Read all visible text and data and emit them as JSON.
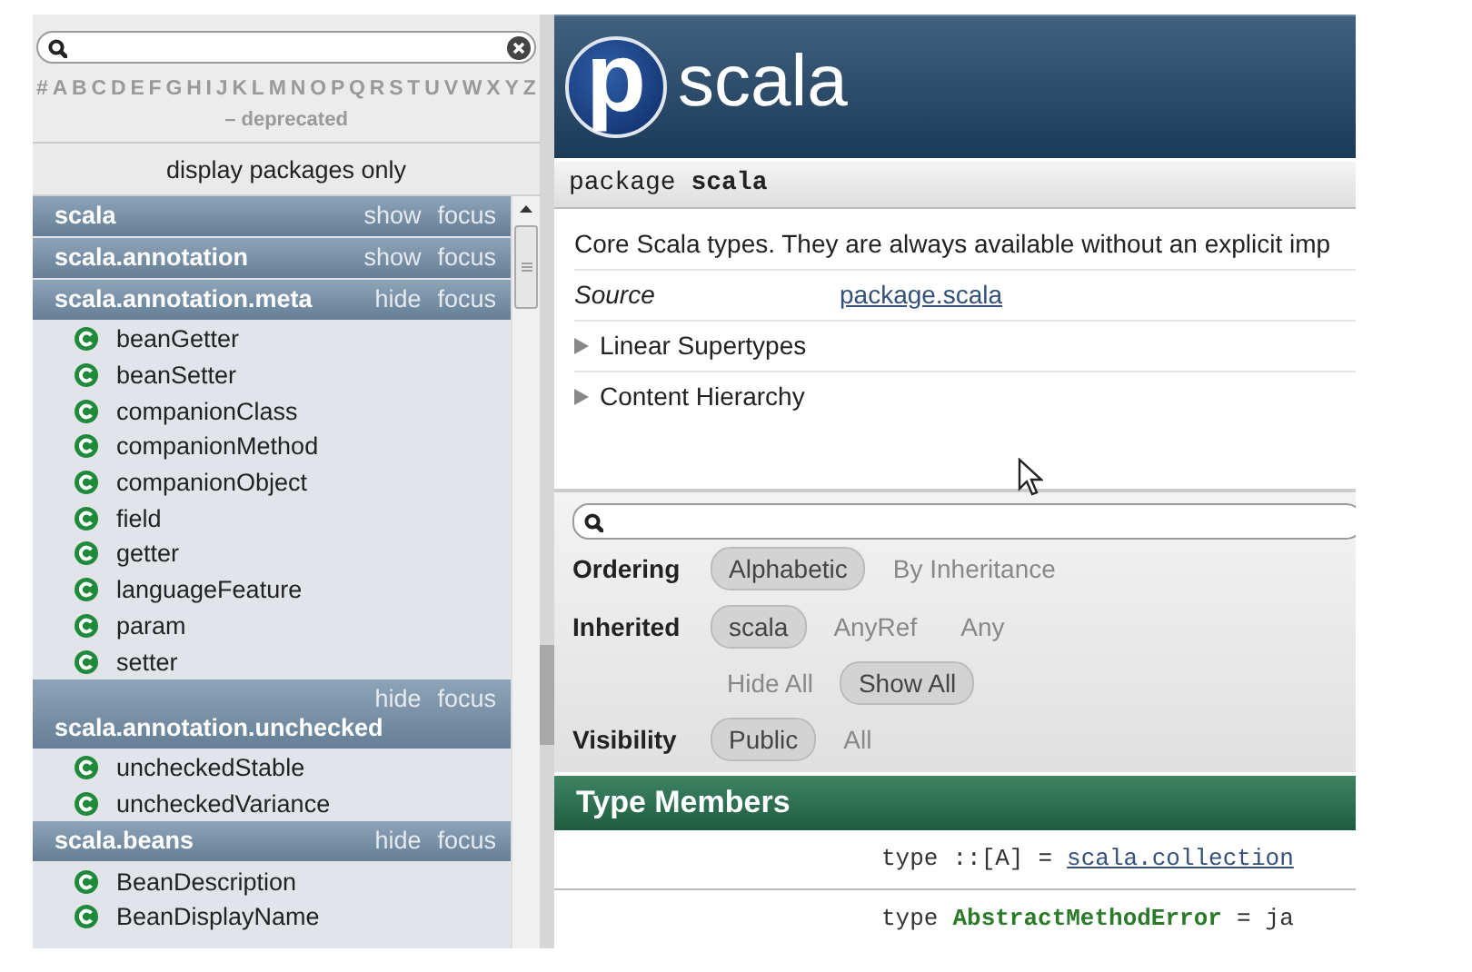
{
  "sidebar": {
    "letters": [
      "#",
      "A",
      "B",
      "C",
      "D",
      "E",
      "F",
      "G",
      "H",
      "I",
      "J",
      "K",
      "L",
      "M",
      "N",
      "O",
      "P",
      "Q",
      "R",
      "S",
      "T",
      "U",
      "V",
      "W",
      "X",
      "Y",
      "Z"
    ],
    "deprecated": "– deprecated",
    "display_packages_only": "display packages only",
    "packages": [
      {
        "name": "scala",
        "toggle": "show",
        "focus": "focus"
      },
      {
        "name": "scala.annotation",
        "toggle": "show",
        "focus": "focus"
      },
      {
        "name": "scala.annotation.meta",
        "toggle": "hide",
        "focus": "focus",
        "members": [
          "beanGetter",
          "beanSetter",
          "companionClass",
          "companionMethod",
          "companionObject",
          "field",
          "getter",
          "languageFeature",
          "param",
          "setter"
        ]
      },
      {
        "name": "scala.annotation.unchecked",
        "toggle": "hide",
        "focus": "focus",
        "members": [
          "uncheckedStable",
          "uncheckedVariance"
        ]
      },
      {
        "name": "scala.beans",
        "toggle": "hide",
        "focus": "focus",
        "members": [
          "BeanDescription",
          "BeanDisplayName"
        ]
      }
    ]
  },
  "header": {
    "logo_letter": "p",
    "title": "scala"
  },
  "package_bar": "package **scala**",
  "description": "Core Scala types. They are always available without an explicit imp",
  "source": {
    "label": "Source",
    "link": "package.scala"
  },
  "expanders": [
    {
      "label": "Linear Supertypes",
      "expanded": false
    },
    {
      "label": "Content Hierarchy",
      "expanded": false
    }
  ],
  "filter": {
    "rows": [
      {
        "label": "Ordering",
        "options": [
          {
            "label": "Alphabetic",
            "selected": true
          },
          {
            "label": "By Inheritance",
            "selected": false
          }
        ]
      },
      {
        "label": "Inherited",
        "options": [
          {
            "label": "scala",
            "selected": true
          },
          {
            "label": "AnyRef",
            "selected": false
          },
          {
            "label": "Any",
            "selected": false
          }
        ]
      },
      {
        "options": [
          {
            "label": "Hide All",
            "selected": false
          },
          {
            "label": "Show All",
            "selected": true
          }
        ]
      },
      {
        "label": "Visibility",
        "options": [
          {
            "label": "Public",
            "selected": true
          },
          {
            "label": "All",
            "selected": false
          }
        ]
      }
    ]
  },
  "type_members": {
    "title": "Type Members",
    "members": [
      {
        "keyword": "type",
        "name": "::[A]",
        "highlight": false,
        "equals": "=",
        "target": "scala.collection",
        "target_link": true
      },
      {
        "keyword": "type",
        "name": "AbstractMethodError",
        "highlight": true,
        "equals": "=",
        "target": "ja",
        "target_link": false
      }
    ]
  }
}
